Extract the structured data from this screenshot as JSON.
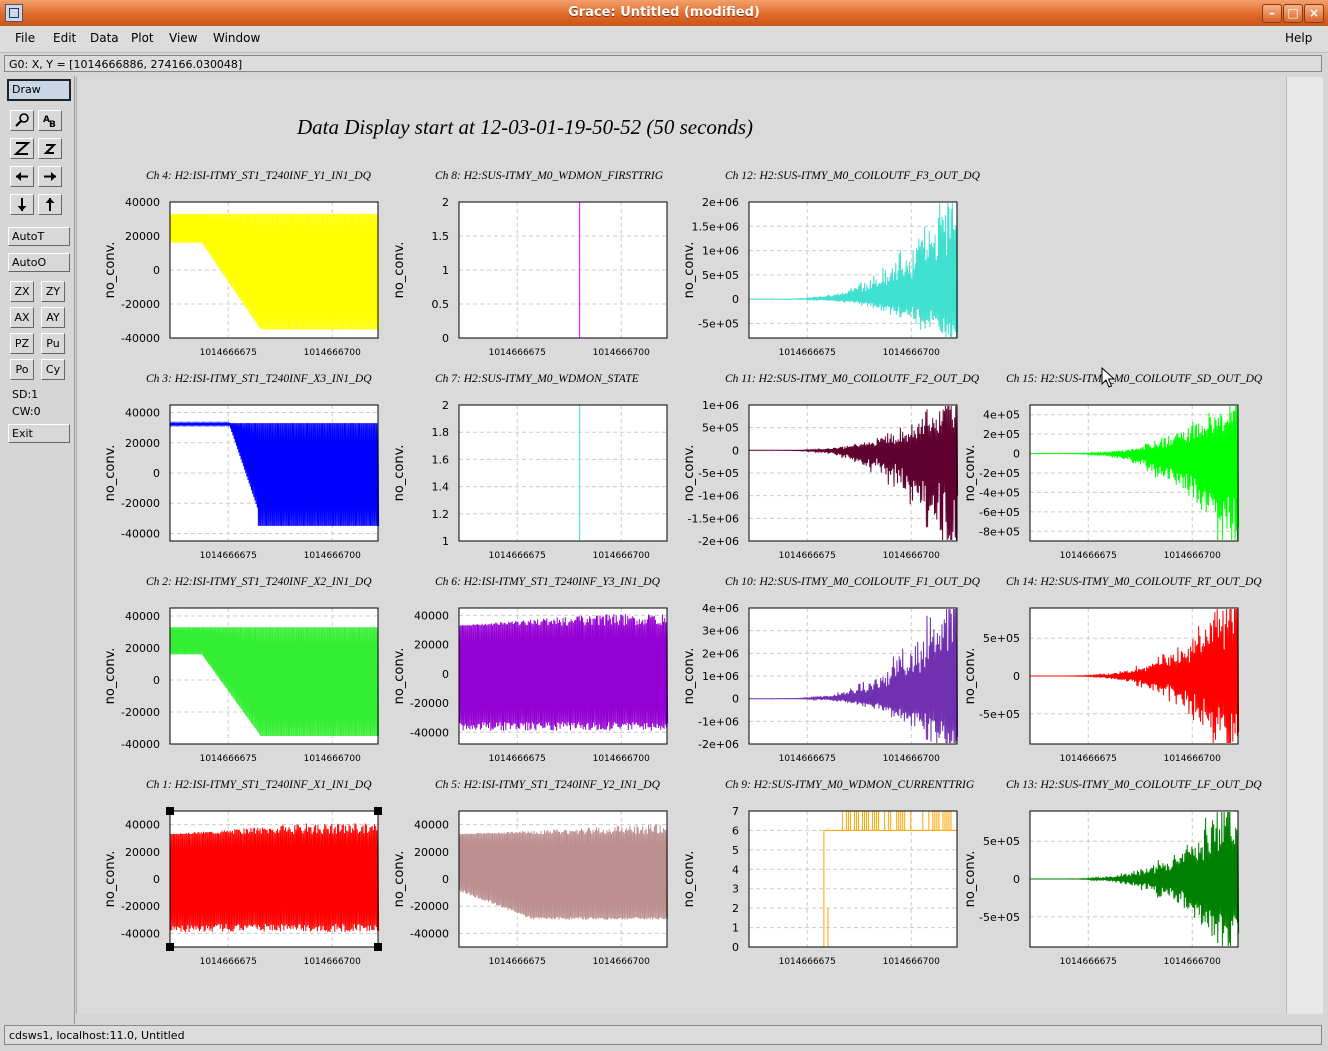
{
  "window": {
    "title": "Grace: Untitled (modified)",
    "controls": [
      "minimize",
      "maximize",
      "close"
    ]
  },
  "menubar": {
    "items": [
      {
        "label": "File",
        "name": "file"
      },
      {
        "label": "Edit",
        "name": "edit"
      },
      {
        "label": "Data",
        "name": "data"
      },
      {
        "label": "Plot",
        "name": "plot"
      },
      {
        "label": "View",
        "name": "view"
      },
      {
        "label": "Window",
        "name": "window"
      }
    ],
    "help": "Help"
  },
  "locator": "G0: X, Y = [1014666886, 274166.030048]",
  "toolbar": {
    "draw": "Draw",
    "autot": "AutoT",
    "autoo": "AutoO",
    "pairs": [
      [
        "ZX",
        "ZY"
      ],
      [
        "AX",
        "AY"
      ],
      [
        "PZ",
        "Pu"
      ],
      [
        "Po",
        "Cy"
      ]
    ],
    "sd": "SD:1",
    "cw": "CW:0",
    "exit": "Exit"
  },
  "status": "cdsws1, localhost:11.0, Untitled",
  "canvas_title": "Data Display start at 12-03-01-19-50-52 (50 seconds)",
  "ylabel": "no_conv.",
  "xticks": [
    "1014666675",
    "1014666700"
  ],
  "panels": [
    {
      "title": "Ch 4: H2:ISI-ITMY_ST1_T240INF_Y1_IN1_DQ",
      "col": 0,
      "row": 0,
      "color": "#ffff00",
      "yticks": [
        "40000",
        "20000",
        "0",
        "-20000",
        "-40000"
      ],
      "ylim": [
        -40000,
        40000
      ],
      "shape": "sat"
    },
    {
      "title": "Ch 8: H2:SUS-ITMY_M0_WDMON_FIRSTTRIG",
      "col": 1,
      "row": 0,
      "color": "#ff00ff",
      "yticks": [
        "2",
        "1.5",
        "1",
        "0.5",
        "0"
      ],
      "ylim": [
        0,
        2
      ],
      "shape": "spike"
    },
    {
      "title": "Ch 12: H2:SUS-ITMY_M0_COILOUTF_F3_OUT_DQ",
      "col": 2,
      "row": 0,
      "color": "#40e0d0",
      "yticks": [
        "2e+06",
        "1.5e+06",
        "1e+06",
        "5e+05",
        "0",
        "-5e+05"
      ],
      "ylim": [
        -800000,
        2000000
      ],
      "shape": "grow"
    },
    {
      "title": "Ch 3: H2:ISI-ITMY_ST1_T240INF_X3_IN1_DQ",
      "col": 0,
      "row": 1,
      "color": "#0000ff",
      "yticks": [
        "40000",
        "20000",
        "0",
        "-20000",
        "-40000"
      ],
      "ylim": [
        -45000,
        45000
      ],
      "shape": "drop"
    },
    {
      "title": "Ch 7: H2:SUS-ITMY_M0_WDMON_STATE",
      "col": 1,
      "row": 1,
      "color": "#40e0d0",
      "yticks": [
        "2",
        "1.8",
        "1.6",
        "1.4",
        "1.2",
        "1"
      ],
      "ylim": [
        1,
        2
      ],
      "shape": "spike"
    },
    {
      "title": "Ch 11: H2:SUS-ITMY_M0_COILOUTF_F2_OUT_DQ",
      "col": 2,
      "row": 1,
      "color": "#600030",
      "yticks": [
        "1e+06",
        "5e+05",
        "0",
        "-5e+05",
        "-1e+06",
        "-1.5e+06",
        "-2e+06"
      ],
      "ylim": [
        -2000000,
        1000000
      ],
      "shape": "grow"
    },
    {
      "title": "Ch 15: H2:SUS-ITMY_M0_COILOUTF_SD_OUT_DQ",
      "col": 3,
      "row": 1,
      "color": "#00ff00",
      "yticks": [
        "4e+05",
        "2e+05",
        "0",
        "-2e+05",
        "-4e+05",
        "-6e+05",
        "-8e+05"
      ],
      "ylim": [
        -900000,
        500000
      ],
      "shape": "grow"
    },
    {
      "title": "Ch 2: H2:ISI-ITMY_ST1_T240INF_X2_IN1_DQ",
      "col": 0,
      "row": 2,
      "color": "#33ee33",
      "yticks": [
        "40000",
        "20000",
        "0",
        "-20000",
        "-40000"
      ],
      "ylim": [
        -40000,
        45000
      ],
      "shape": "sat"
    },
    {
      "title": "Ch 6: H2:ISI-ITMY_ST1_T240INF_Y3_IN1_DQ",
      "col": 1,
      "row": 2,
      "color": "#9400d3",
      "yticks": [
        "40000",
        "20000",
        "0",
        "-20000",
        "-40000"
      ],
      "ylim": [
        -48000,
        45000
      ],
      "shape": "full"
    },
    {
      "title": "Ch 10: H2:SUS-ITMY_M0_COILOUTF_F1_OUT_DQ",
      "col": 2,
      "row": 2,
      "color": "#7030b0",
      "yticks": [
        "4e+06",
        "3e+06",
        "2e+06",
        "1e+06",
        "0",
        "-1e+06",
        "-2e+06"
      ],
      "ylim": [
        -2000000,
        4000000
      ],
      "shape": "grow"
    },
    {
      "title": "Ch 14: H2:SUS-ITMY_M0_COILOUTF_RT_OUT_DQ",
      "col": 3,
      "row": 2,
      "color": "#ff0000",
      "yticks": [
        "5e+05",
        "0",
        "-5e+05"
      ],
      "ylim": [
        -900000,
        900000
      ],
      "shape": "grow"
    },
    {
      "title": "Ch 1: H2:ISI-ITMY_ST1_T240INF_X1_IN1_DQ",
      "col": 0,
      "row": 3,
      "color": "#ff0000",
      "yticks": [
        "40000",
        "20000",
        "0",
        "-20000",
        "-40000"
      ],
      "ylim": [
        -50000,
        50000
      ],
      "shape": "full",
      "selected": true
    },
    {
      "title": "Ch 5: H2:ISI-ITMY_ST1_T240INF_Y2_IN1_DQ",
      "col": 1,
      "row": 3,
      "color": "#bc8f8f",
      "yticks": [
        "40000",
        "20000",
        "0",
        "-20000",
        "-40000"
      ],
      "ylim": [
        -50000,
        50000
      ],
      "shape": "sag"
    },
    {
      "title": "Ch 9: H2:SUS-ITMY_M0_WDMON_CURRENTTRIG",
      "col": 2,
      "row": 3,
      "color": "#ffa500",
      "yticks": [
        "7",
        "6",
        "5",
        "4",
        "3",
        "2",
        "1",
        "0"
      ],
      "ylim": [
        0,
        7
      ],
      "shape": "step"
    },
    {
      "title": "Ch 13: H2:SUS-ITMY_M0_COILOUTF_LF_OUT_DQ",
      "col": 3,
      "row": 3,
      "color": "#008000",
      "yticks": [
        "5e+05",
        "0",
        "-5e+05"
      ],
      "ylim": [
        -900000,
        900000
      ],
      "shape": "grow"
    }
  ]
}
